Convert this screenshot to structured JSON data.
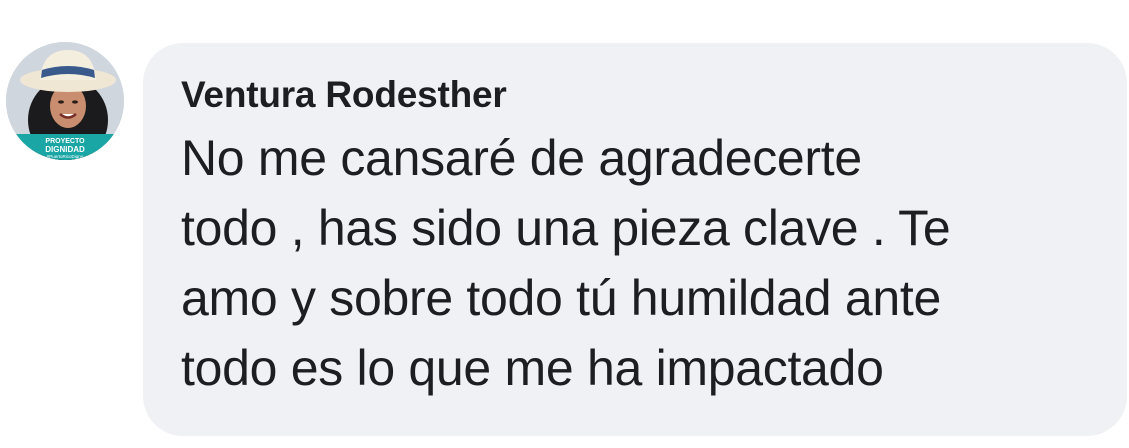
{
  "comment": {
    "author": "Ventura Rodesther",
    "lines": [
      "No me cansaré de agradecerte",
      "todo , has sido una pieza clave . Te",
      "amo y sobre todo tú humildad ante",
      "todo es lo que me ha impactado"
    ]
  },
  "avatar": {
    "badge_line1": "PROYECTO",
    "badge_line2": "DIGNIDAD",
    "badge_line3": "#PuertoRicoDigno"
  },
  "colors": {
    "bubble_bg": "#f0f1f4",
    "text": "#1c1e21",
    "badge": "#1aa6a4"
  }
}
